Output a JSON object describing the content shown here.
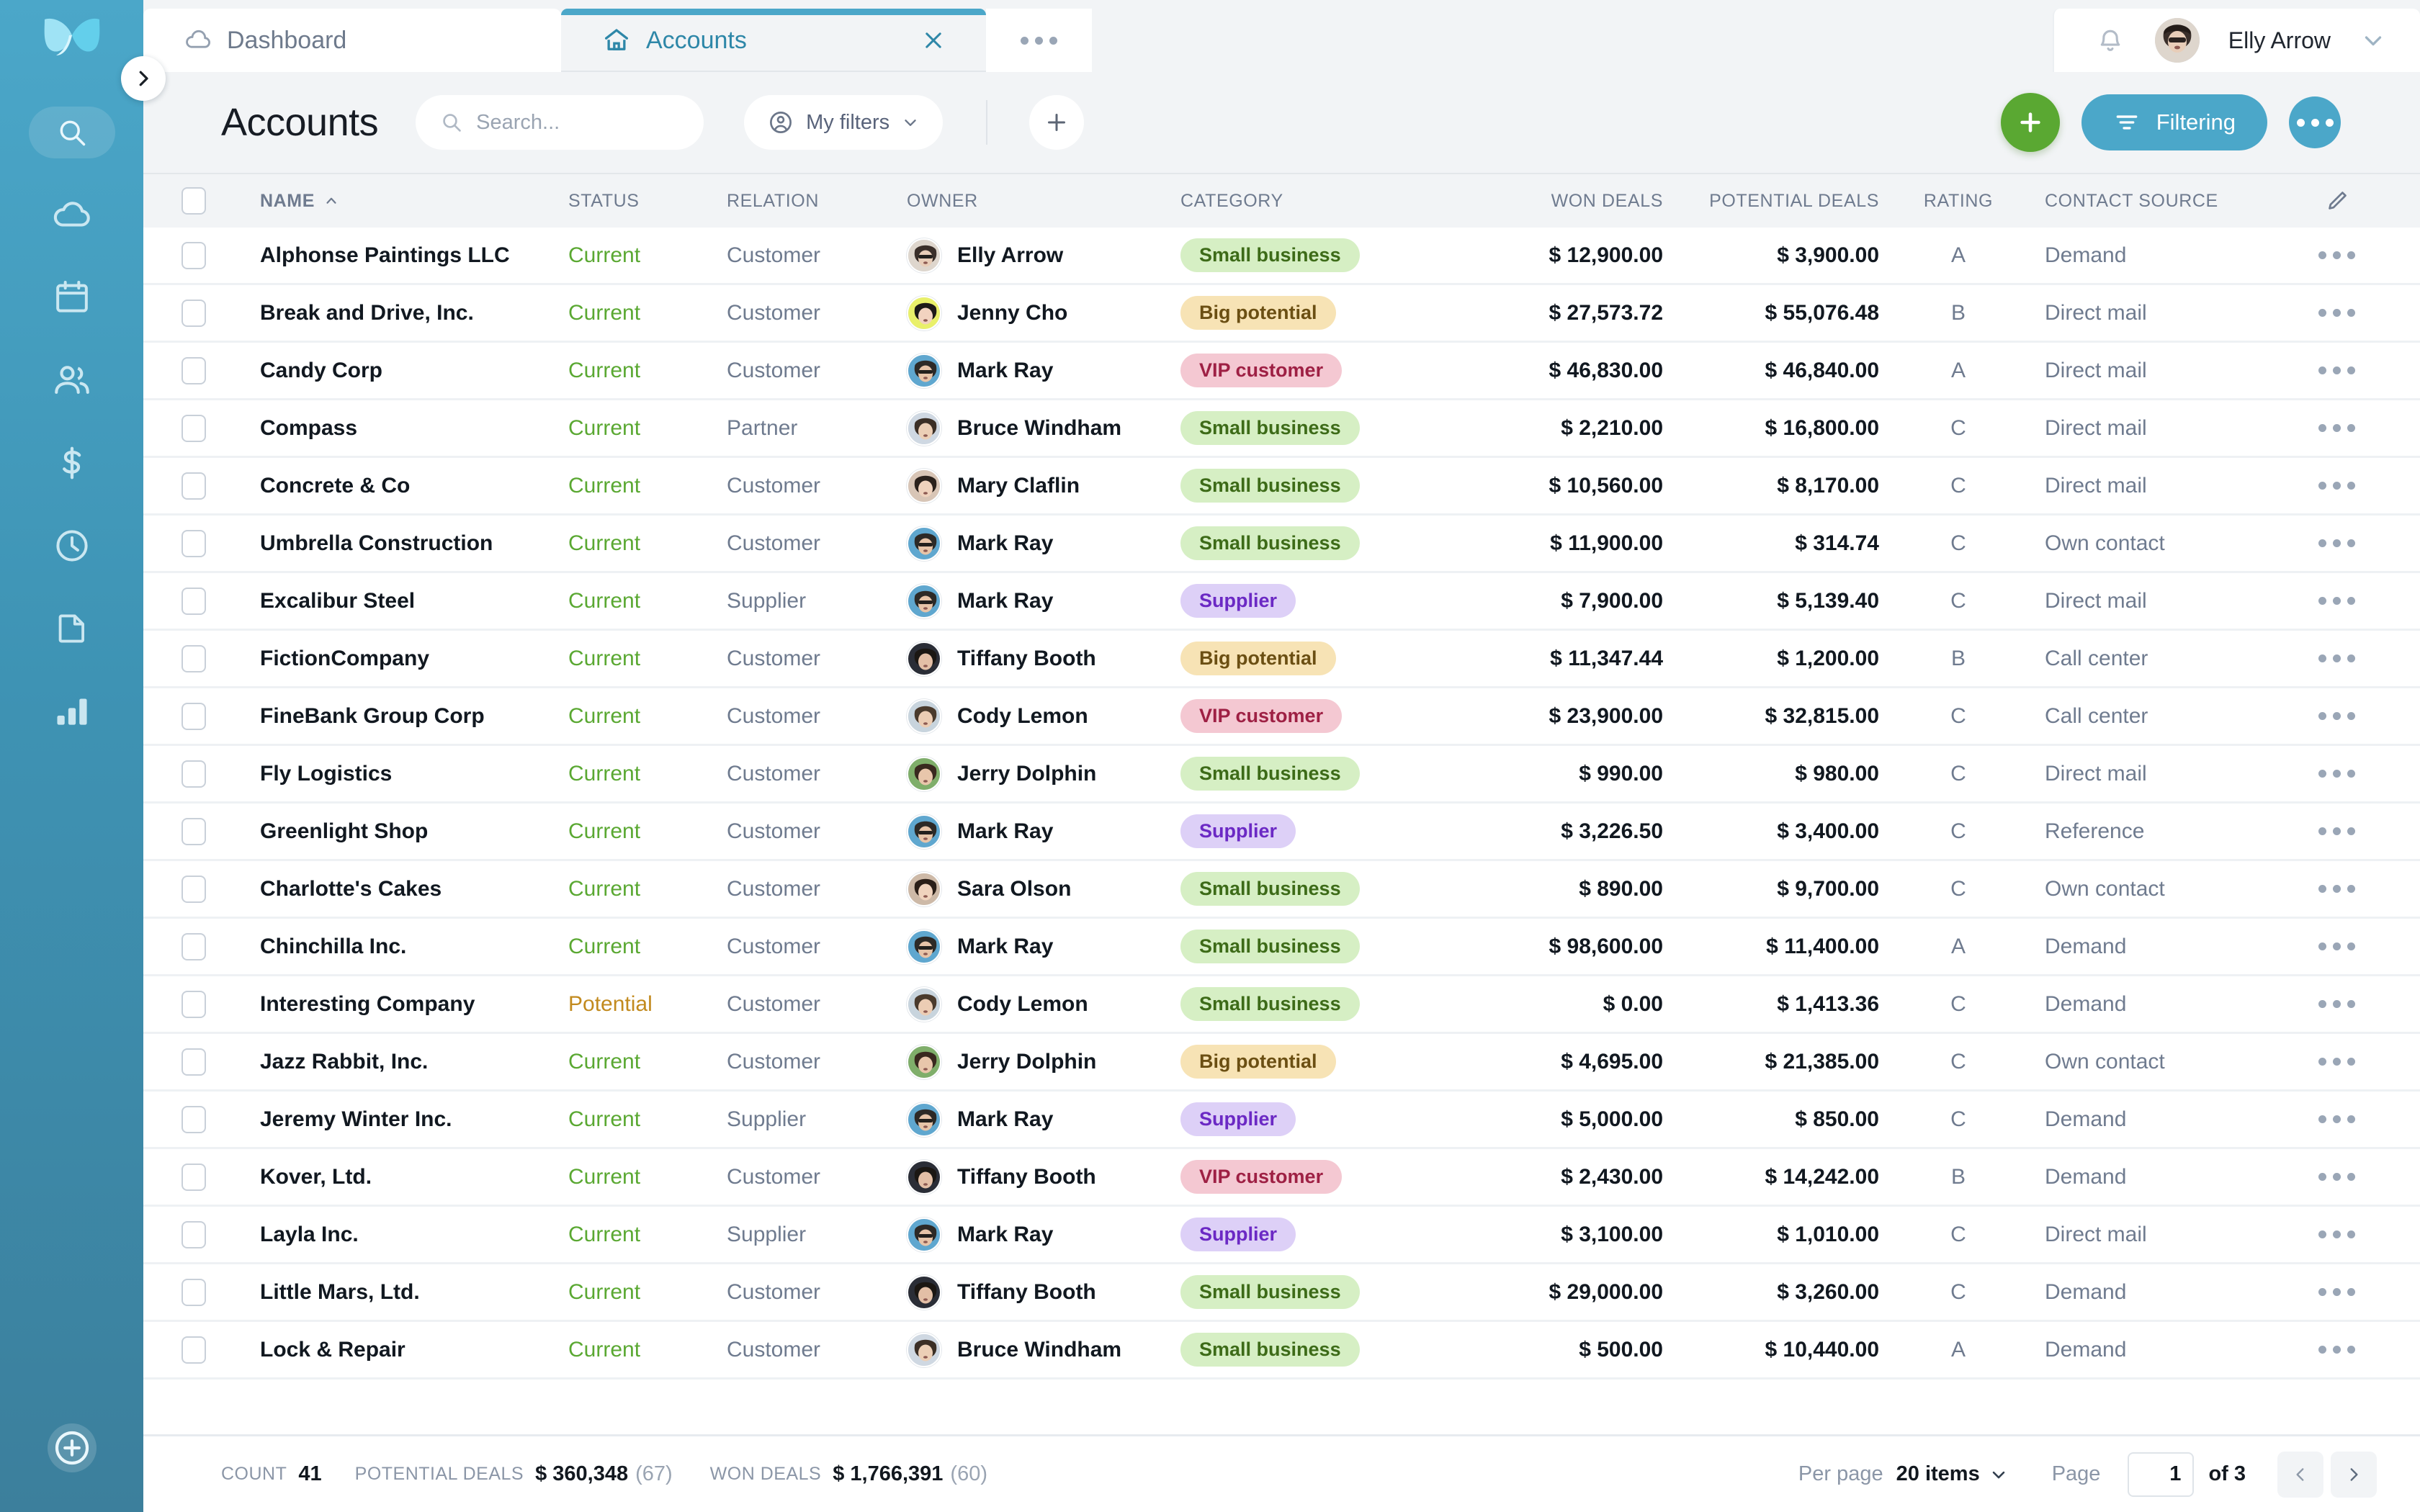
{
  "sidebar": {
    "items": [
      {
        "icon": "search-icon",
        "name": "sidebar-search"
      },
      {
        "icon": "cloud-icon",
        "name": "sidebar-dashboard"
      },
      {
        "icon": "calendar-icon",
        "name": "sidebar-calendar"
      },
      {
        "icon": "people-icon",
        "name": "sidebar-contacts"
      },
      {
        "icon": "dollar-icon",
        "name": "sidebar-deals"
      },
      {
        "icon": "clock-icon",
        "name": "sidebar-activity"
      },
      {
        "icon": "document-icon",
        "name": "sidebar-documents"
      },
      {
        "icon": "bar-chart-icon",
        "name": "sidebar-reports"
      }
    ],
    "add_button_icon": "plus-circle-icon",
    "collapse_icon": "chevron-right-icon"
  },
  "topbar": {
    "tabs": [
      {
        "label": "Dashboard",
        "icon": "cloud-icon",
        "active": false,
        "closable": false
      },
      {
        "label": "Accounts",
        "icon": "home-icon",
        "active": true,
        "closable": true
      }
    ],
    "more_tabs_icon": "ellipsis-icon",
    "notification_icon": "bell-icon",
    "user": "Elly Arrow",
    "user_chevron_icon": "chevron-down-icon"
  },
  "header": {
    "title": "Accounts",
    "search_placeholder": "Search...",
    "search_icon": "search-icon",
    "search_value": "",
    "my_filters_label": "My filters",
    "my_filters_icon": "user-circle-icon",
    "my_filters_chevron": "chevron-down-icon",
    "add_view_icon": "plus-icon",
    "create_button_icon": "plus-icon",
    "filtering_label": "Filtering",
    "filtering_icon": "filter-icon",
    "more_actions_icon": "ellipsis-icon"
  },
  "colors": {
    "brand": "#4ba7c9",
    "green": "#5aa832",
    "status_current": "#5aa832",
    "status_potential": "#c28a1e"
  },
  "table": {
    "select_all_name": "select-all-checkbox",
    "sort_column": "NAME",
    "sort_icon": "caret-up-icon",
    "edit_columns_icon": "pencil-icon",
    "row_menu_icon": "ellipsis-icon",
    "columns": [
      "NAME",
      "STATUS",
      "RELATION",
      "OWNER",
      "CATEGORY",
      "WON DEALS",
      "POTENTIAL DEALS",
      "RATING",
      "CONTACT SOURCE"
    ],
    "rows": [
      {
        "name": "Alphonse Paintings LLC",
        "status": "Current",
        "relation": "Customer",
        "owner": "Elly Arrow",
        "category": "Small business",
        "won": "$ 12,900.00",
        "potential": "$ 3,900.00",
        "rating": "A",
        "source": "Demand"
      },
      {
        "name": "Break and Drive, Inc.",
        "status": "Current",
        "relation": "Customer",
        "owner": "Jenny Cho",
        "category": "Big potential",
        "won": "$ 27,573.72",
        "potential": "$ 55,076.48",
        "rating": "B",
        "source": "Direct mail"
      },
      {
        "name": "Candy Corp",
        "status": "Current",
        "relation": "Customer",
        "owner": "Mark Ray",
        "category": "VIP customer",
        "won": "$ 46,830.00",
        "potential": "$ 46,840.00",
        "rating": "A",
        "source": "Direct mail"
      },
      {
        "name": "Compass",
        "status": "Current",
        "relation": "Partner",
        "owner": "Bruce Windham",
        "category": "Small business",
        "won": "$ 2,210.00",
        "potential": "$ 16,800.00",
        "rating": "C",
        "source": "Direct mail"
      },
      {
        "name": "Concrete & Co",
        "status": "Current",
        "relation": "Customer",
        "owner": "Mary Claflin",
        "category": "Small business",
        "won": "$ 10,560.00",
        "potential": "$ 8,170.00",
        "rating": "C",
        "source": "Direct mail"
      },
      {
        "name": "Umbrella Construction",
        "status": "Current",
        "relation": "Customer",
        "owner": "Mark Ray",
        "category": "Small business",
        "won": "$ 11,900.00",
        "potential": "$ 314.74",
        "rating": "C",
        "source": "Own contact"
      },
      {
        "name": "Excalibur Steel",
        "status": "Current",
        "relation": "Supplier",
        "owner": "Mark Ray",
        "category": "Supplier",
        "won": "$ 7,900.00",
        "potential": "$ 5,139.40",
        "rating": "C",
        "source": "Direct mail"
      },
      {
        "name": "FictionCompany",
        "status": "Current",
        "relation": "Customer",
        "owner": "Tiffany Booth",
        "category": "Big potential",
        "won": "$ 11,347.44",
        "potential": "$ 1,200.00",
        "rating": "B",
        "source": "Call center"
      },
      {
        "name": "FineBank Group Corp",
        "status": "Current",
        "relation": "Customer",
        "owner": "Cody Lemon",
        "category": "VIP customer",
        "won": "$ 23,900.00",
        "potential": "$ 32,815.00",
        "rating": "C",
        "source": "Call center"
      },
      {
        "name": "Fly Logistics",
        "status": "Current",
        "relation": "Customer",
        "owner": "Jerry Dolphin",
        "category": "Small business",
        "won": "$ 990.00",
        "potential": "$ 980.00",
        "rating": "C",
        "source": "Direct mail"
      },
      {
        "name": "Greenlight Shop",
        "status": "Current",
        "relation": "Customer",
        "owner": "Mark Ray",
        "category": "Supplier",
        "won": "$ 3,226.50",
        "potential": "$ 3,400.00",
        "rating": "C",
        "source": "Reference"
      },
      {
        "name": "Charlotte's Cakes",
        "status": "Current",
        "relation": "Customer",
        "owner": "Sara Olson",
        "category": "Small business",
        "won": "$ 890.00",
        "potential": "$ 9,700.00",
        "rating": "C",
        "source": "Own contact"
      },
      {
        "name": "Chinchilla Inc.",
        "status": "Current",
        "relation": "Customer",
        "owner": "Mark Ray",
        "category": "Small business",
        "won": "$ 98,600.00",
        "potential": "$ 11,400.00",
        "rating": "A",
        "source": "Demand"
      },
      {
        "name": "Interesting Company",
        "status": "Potential",
        "relation": "Customer",
        "owner": "Cody Lemon",
        "category": "Small business",
        "won": "$ 0.00",
        "potential": "$ 1,413.36",
        "rating": "C",
        "source": "Demand"
      },
      {
        "name": "Jazz Rabbit, Inc.",
        "status": "Current",
        "relation": "Customer",
        "owner": "Jerry Dolphin",
        "category": "Big potential",
        "won": "$ 4,695.00",
        "potential": "$ 21,385.00",
        "rating": "C",
        "source": "Own contact"
      },
      {
        "name": "Jeremy Winter Inc.",
        "status": "Current",
        "relation": "Supplier",
        "owner": "Mark Ray",
        "category": "Supplier",
        "won": "$ 5,000.00",
        "potential": "$ 850.00",
        "rating": "C",
        "source": "Demand"
      },
      {
        "name": "Kover, Ltd.",
        "status": "Current",
        "relation": "Customer",
        "owner": "Tiffany Booth",
        "category": "VIP customer",
        "won": "$ 2,430.00",
        "potential": "$ 14,242.00",
        "rating": "B",
        "source": "Demand"
      },
      {
        "name": "Layla Inc.",
        "status": "Current",
        "relation": "Supplier",
        "owner": "Mark Ray",
        "category": "Supplier",
        "won": "$ 3,100.00",
        "potential": "$ 1,010.00",
        "rating": "C",
        "source": "Direct mail"
      },
      {
        "name": "Little Mars, Ltd.",
        "status": "Current",
        "relation": "Customer",
        "owner": "Tiffany Booth",
        "category": "Small business",
        "won": "$ 29,000.00",
        "potential": "$ 3,260.00",
        "rating": "C",
        "source": "Demand"
      },
      {
        "name": "Lock & Repair",
        "status": "Current",
        "relation": "Customer",
        "owner": "Bruce Windham",
        "category": "Small business",
        "won": "$ 500.00",
        "potential": "$ 10,440.00",
        "rating": "A",
        "source": "Demand"
      }
    ]
  },
  "footer": {
    "count_label": "COUNT",
    "count_value": "41",
    "potential_label": "POTENTIAL DEALS",
    "potential_value": "$ 360,348",
    "potential_sub": "(67)",
    "won_label": "WON DEALS",
    "won_value": "$ 1,766,391",
    "won_sub": "(60)",
    "per_page_label": "Per page",
    "per_page_value": "20 items",
    "per_page_chevron": "chevron-down-icon",
    "page_label": "Page",
    "page_value": "1",
    "page_of": "of 3",
    "prev_icon": "chevron-left-icon",
    "next_icon": "chevron-right-icon"
  }
}
